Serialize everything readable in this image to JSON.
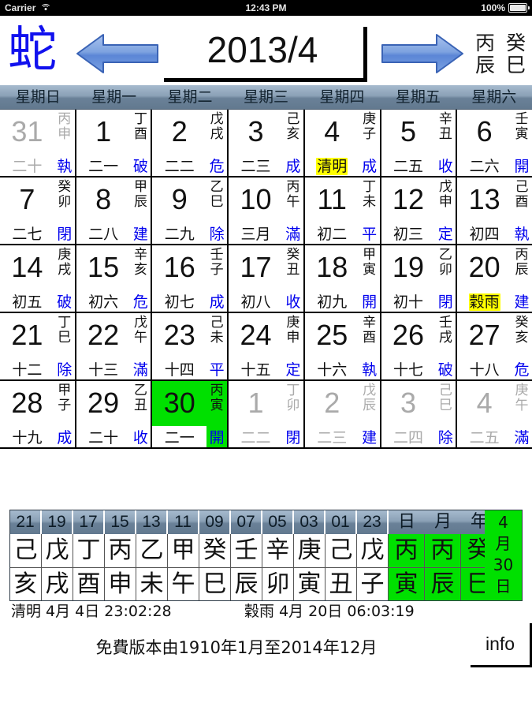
{
  "status_bar": {
    "carrier": "Carrier",
    "time": "12:43 PM",
    "battery": "100%",
    "wifi_icon": "wifi-icon",
    "battery_icon": "battery-icon"
  },
  "topbar": {
    "zodiac": "蛇",
    "prev_icon": "left-arrow-icon",
    "next_icon": "right-arrow-icon",
    "year_month": "2013/4",
    "month_stem": "丙",
    "month_branch": "辰",
    "year_stem": "癸",
    "year_branch": "巳"
  },
  "weekdays": [
    "星期日",
    "星期一",
    "星期二",
    "星期三",
    "星期四",
    "星期五",
    "星期六"
  ],
  "calendar": {
    "weeks": [
      [
        {
          "day": "31",
          "stem": "丙",
          "branch": "申",
          "lunar": "二十",
          "twelve": "執",
          "dim": true,
          "term": "",
          "today": false
        },
        {
          "day": "1",
          "stem": "丁",
          "branch": "酉",
          "lunar": "二一",
          "twelve": "破",
          "dim": false,
          "term": "",
          "today": false
        },
        {
          "day": "2",
          "stem": "戊",
          "branch": "戌",
          "lunar": "二二",
          "twelve": "危",
          "dim": false,
          "term": "",
          "today": false
        },
        {
          "day": "3",
          "stem": "己",
          "branch": "亥",
          "lunar": "二三",
          "twelve": "成",
          "dim": false,
          "term": "",
          "today": false
        },
        {
          "day": "4",
          "stem": "庚",
          "branch": "子",
          "lunar": "",
          "twelve": "成",
          "dim": false,
          "term": "清明",
          "today": false
        },
        {
          "day": "5",
          "stem": "辛",
          "branch": "丑",
          "lunar": "二五",
          "twelve": "收",
          "dim": false,
          "term": "",
          "today": false
        },
        {
          "day": "6",
          "stem": "壬",
          "branch": "寅",
          "lunar": "二六",
          "twelve": "開",
          "dim": false,
          "term": "",
          "today": false
        }
      ],
      [
        {
          "day": "7",
          "stem": "癸",
          "branch": "卯",
          "lunar": "二七",
          "twelve": "閉",
          "dim": false,
          "term": "",
          "today": false
        },
        {
          "day": "8",
          "stem": "甲",
          "branch": "辰",
          "lunar": "二八",
          "twelve": "建",
          "dim": false,
          "term": "",
          "today": false
        },
        {
          "day": "9",
          "stem": "乙",
          "branch": "巳",
          "lunar": "二九",
          "twelve": "除",
          "dim": false,
          "term": "",
          "today": false
        },
        {
          "day": "10",
          "stem": "丙",
          "branch": "午",
          "lunar": "三月",
          "twelve": "滿",
          "dim": false,
          "term": "",
          "today": false
        },
        {
          "day": "11",
          "stem": "丁",
          "branch": "未",
          "lunar": "初二",
          "twelve": "平",
          "dim": false,
          "term": "",
          "today": false
        },
        {
          "day": "12",
          "stem": "戊",
          "branch": "申",
          "lunar": "初三",
          "twelve": "定",
          "dim": false,
          "term": "",
          "today": false
        },
        {
          "day": "13",
          "stem": "己",
          "branch": "酉",
          "lunar": "初四",
          "twelve": "執",
          "dim": false,
          "term": "",
          "today": false
        }
      ],
      [
        {
          "day": "14",
          "stem": "庚",
          "branch": "戌",
          "lunar": "初五",
          "twelve": "破",
          "dim": false,
          "term": "",
          "today": false
        },
        {
          "day": "15",
          "stem": "辛",
          "branch": "亥",
          "lunar": "初六",
          "twelve": "危",
          "dim": false,
          "term": "",
          "today": false
        },
        {
          "day": "16",
          "stem": "壬",
          "branch": "子",
          "lunar": "初七",
          "twelve": "成",
          "dim": false,
          "term": "",
          "today": false
        },
        {
          "day": "17",
          "stem": "癸",
          "branch": "丑",
          "lunar": "初八",
          "twelve": "收",
          "dim": false,
          "term": "",
          "today": false
        },
        {
          "day": "18",
          "stem": "甲",
          "branch": "寅",
          "lunar": "初九",
          "twelve": "開",
          "dim": false,
          "term": "",
          "today": false
        },
        {
          "day": "19",
          "stem": "乙",
          "branch": "卯",
          "lunar": "初十",
          "twelve": "閉",
          "dim": false,
          "term": "",
          "today": false
        },
        {
          "day": "20",
          "stem": "丙",
          "branch": "辰",
          "lunar": "",
          "twelve": "建",
          "dim": false,
          "term": "穀雨",
          "today": false
        }
      ],
      [
        {
          "day": "21",
          "stem": "丁",
          "branch": "巳",
          "lunar": "十二",
          "twelve": "除",
          "dim": false,
          "term": "",
          "today": false
        },
        {
          "day": "22",
          "stem": "戊",
          "branch": "午",
          "lunar": "十三",
          "twelve": "滿",
          "dim": false,
          "term": "",
          "today": false
        },
        {
          "day": "23",
          "stem": "己",
          "branch": "未",
          "lunar": "十四",
          "twelve": "平",
          "dim": false,
          "term": "",
          "today": false
        },
        {
          "day": "24",
          "stem": "庚",
          "branch": "申",
          "lunar": "十五",
          "twelve": "定",
          "dim": false,
          "term": "",
          "today": false
        },
        {
          "day": "25",
          "stem": "辛",
          "branch": "酉",
          "lunar": "十六",
          "twelve": "執",
          "dim": false,
          "term": "",
          "today": false
        },
        {
          "day": "26",
          "stem": "壬",
          "branch": "戌",
          "lunar": "十七",
          "twelve": "破",
          "dim": false,
          "term": "",
          "today": false
        },
        {
          "day": "27",
          "stem": "癸",
          "branch": "亥",
          "lunar": "十八",
          "twelve": "危",
          "dim": false,
          "term": "",
          "today": false
        }
      ],
      [
        {
          "day": "28",
          "stem": "甲",
          "branch": "子",
          "lunar": "十九",
          "twelve": "成",
          "dim": false,
          "term": "",
          "today": false
        },
        {
          "day": "29",
          "stem": "乙",
          "branch": "丑",
          "lunar": "二十",
          "twelve": "收",
          "dim": false,
          "term": "",
          "today": false
        },
        {
          "day": "30",
          "stem": "丙",
          "branch": "寅",
          "lunar": "二一",
          "twelve": "開",
          "dim": false,
          "term": "",
          "today": true
        },
        {
          "day": "1",
          "stem": "丁",
          "branch": "卯",
          "lunar": "二二",
          "twelve": "閉",
          "dim": true,
          "term": "",
          "today": false
        },
        {
          "day": "2",
          "stem": "戊",
          "branch": "辰",
          "lunar": "二三",
          "twelve": "建",
          "dim": true,
          "term": "",
          "today": false
        },
        {
          "day": "3",
          "stem": "己",
          "branch": "巳",
          "lunar": "二四",
          "twelve": "除",
          "dim": true,
          "term": "",
          "today": false
        },
        {
          "day": "4",
          "stem": "庚",
          "branch": "午",
          "lunar": "二五",
          "twelve": "滿",
          "dim": true,
          "term": "",
          "today": false
        }
      ]
    ]
  },
  "hour_panel": {
    "hours": [
      "21",
      "19",
      "17",
      "15",
      "13",
      "11",
      "09",
      "07",
      "05",
      "03",
      "01",
      "23"
    ],
    "units": [
      "日",
      "月",
      "年"
    ],
    "stems": [
      "己",
      "戊",
      "丁",
      "丙",
      "乙",
      "甲",
      "癸",
      "壬",
      "辛",
      "庚",
      "己",
      "戊"
    ],
    "branches": [
      "亥",
      "戌",
      "酉",
      "申",
      "未",
      "午",
      "巳",
      "辰",
      "卯",
      "寅",
      "丑",
      "子"
    ],
    "unit_stems": [
      "丙",
      "丙",
      "癸"
    ],
    "unit_branches": [
      "寅",
      "辰",
      "巳"
    ],
    "date_col": [
      "4",
      "月",
      "30",
      "日"
    ]
  },
  "footer": {
    "term1": "清明 4月 4日  23:02:28",
    "term2": "穀雨 4月 20日  06:03:19",
    "free_notice": "免費版本由1910年1月至2014年12月",
    "info_label": "info"
  }
}
